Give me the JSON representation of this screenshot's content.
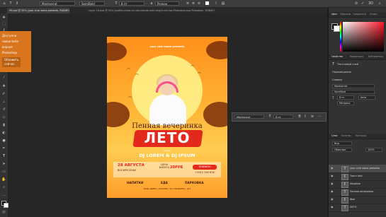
{
  "options_bar": {
    "font_family": "Montserrat",
    "font_style": "SemiBold",
    "anti_alias": "Резкое",
    "font_size": "8 пт"
  },
  "tabs": [
    {
      "label": "99.psd @ 25% (your club name presents, RGB/8*)",
      "active": true
    },
    {
      "label": "Layer 16.psb @ 50% (profile-photo-of-cute-blonde-with-bright-red-lips-Photobom.psp Photobom, RGB/8*)",
      "active": false
    }
  ],
  "notification": {
    "lines": [
      "Доступна",
      "новая beta-",
      "версия",
      "Photoshop."
    ],
    "button_lines": [
      "Обновить",
      "сейчас."
    ]
  },
  "poster": {
    "top_small": "your club name presents",
    "party_word": "Пенная вечеринка",
    "main_word": "ЛЕТО",
    "guest": "guests",
    "djs": "DJ LOREM & DJ IPSUM",
    "date": "28 АВГУСТА",
    "day": "ВОСКРЕСЕНЬЕ",
    "price_label_1": "ЦЕНА",
    "price_label_2": "БИЛЕТА",
    "price": "20РУБ",
    "phone_label": "ТЕЛЕФОН",
    "phone": "+0012 345 678",
    "features": [
      "НАПИТКИ",
      "ЕДА",
      "ПАРКОВКА"
    ],
    "address": "НАШ АДРЕС | МОСКВА, УЛ. ПУШКИНА , Д.3"
  },
  "char_panel": {
    "font": "Montserrat",
    "size": "8 пт"
  },
  "right_panel": {
    "top_tabs": [
      "Цвет",
      "Образцы",
      "Градиенты",
      "Узоры"
    ],
    "props_tabs": [
      "Свойства",
      "Коррекция",
      "Библиотеки"
    ],
    "type_layer": "Текстовый слой",
    "transform": "Перемещение",
    "character": "Символ",
    "font": "Montserrat",
    "style": "SemiBold",
    "size": "8 пт",
    "tracking": "Авто",
    "metrics": "Метрика",
    "layers_tabs": [
      "Слои",
      "Каналы",
      "Контуры"
    ],
    "filter": "Вид",
    "blend": "Обычные",
    "opacity": "100%",
    "layers": [
      {
        "name": "your club name presents",
        "kind": "T",
        "selected": true
      },
      {
        "name": "Текст leto",
        "kind": "F",
        "selected": false
      },
      {
        "name": "Headline",
        "kind": "F",
        "selected": false
      },
      {
        "name": "Пенная вечеринка",
        "kind": "T",
        "selected": false
      },
      {
        "name": "Фон",
        "kind": "F",
        "selected": false
      },
      {
        "name": "ЛЕТО",
        "kind": "T",
        "selected": false
      }
    ]
  },
  "colors": {
    "accent": "#d8751e",
    "poster_red": "#e3281c",
    "panel_bg": "#323232"
  }
}
